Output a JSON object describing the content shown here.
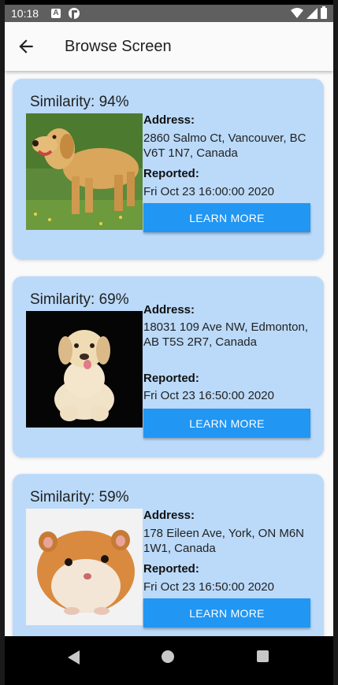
{
  "status_bar": {
    "time": "10:18",
    "notification_icon_a": "A"
  },
  "app_bar": {
    "title": "Browse Screen",
    "back_icon": "arrow-left-icon"
  },
  "colors": {
    "card_background": "#bbdafa",
    "button_accent": "#2196f3"
  },
  "cards": [
    {
      "similarity": "Similarity: 94%",
      "photo": "golden-retriever-photo",
      "address_label": "Address:",
      "address": "2860 Salmo Ct, Vancouver, BC V6T 1N7, Canada",
      "reported_label": "Reported:",
      "reported": "Fri Oct 23 16:00:00 2020",
      "button_label": "LEARN MORE"
    },
    {
      "similarity": "Similarity: 69%",
      "photo": "labrador-puppy-photo",
      "address_label": "Address:",
      "address": "18031 109 Ave NW, Edmonton, AB T5S 2R7, Canada",
      "reported_label": "Reported:",
      "reported": "Fri Oct 23 16:50:00 2020",
      "button_label": "LEARN MORE"
    },
    {
      "similarity": "Similarity: 59%",
      "photo": "hamster-photo",
      "address_label": "Address:",
      "address": "178 Eileen Ave, York, ON M6N 1W1, Canada",
      "reported_label": "Reported:",
      "reported": "Fri Oct 23 16:50:00 2020",
      "button_label": "LEARN MORE"
    }
  ]
}
